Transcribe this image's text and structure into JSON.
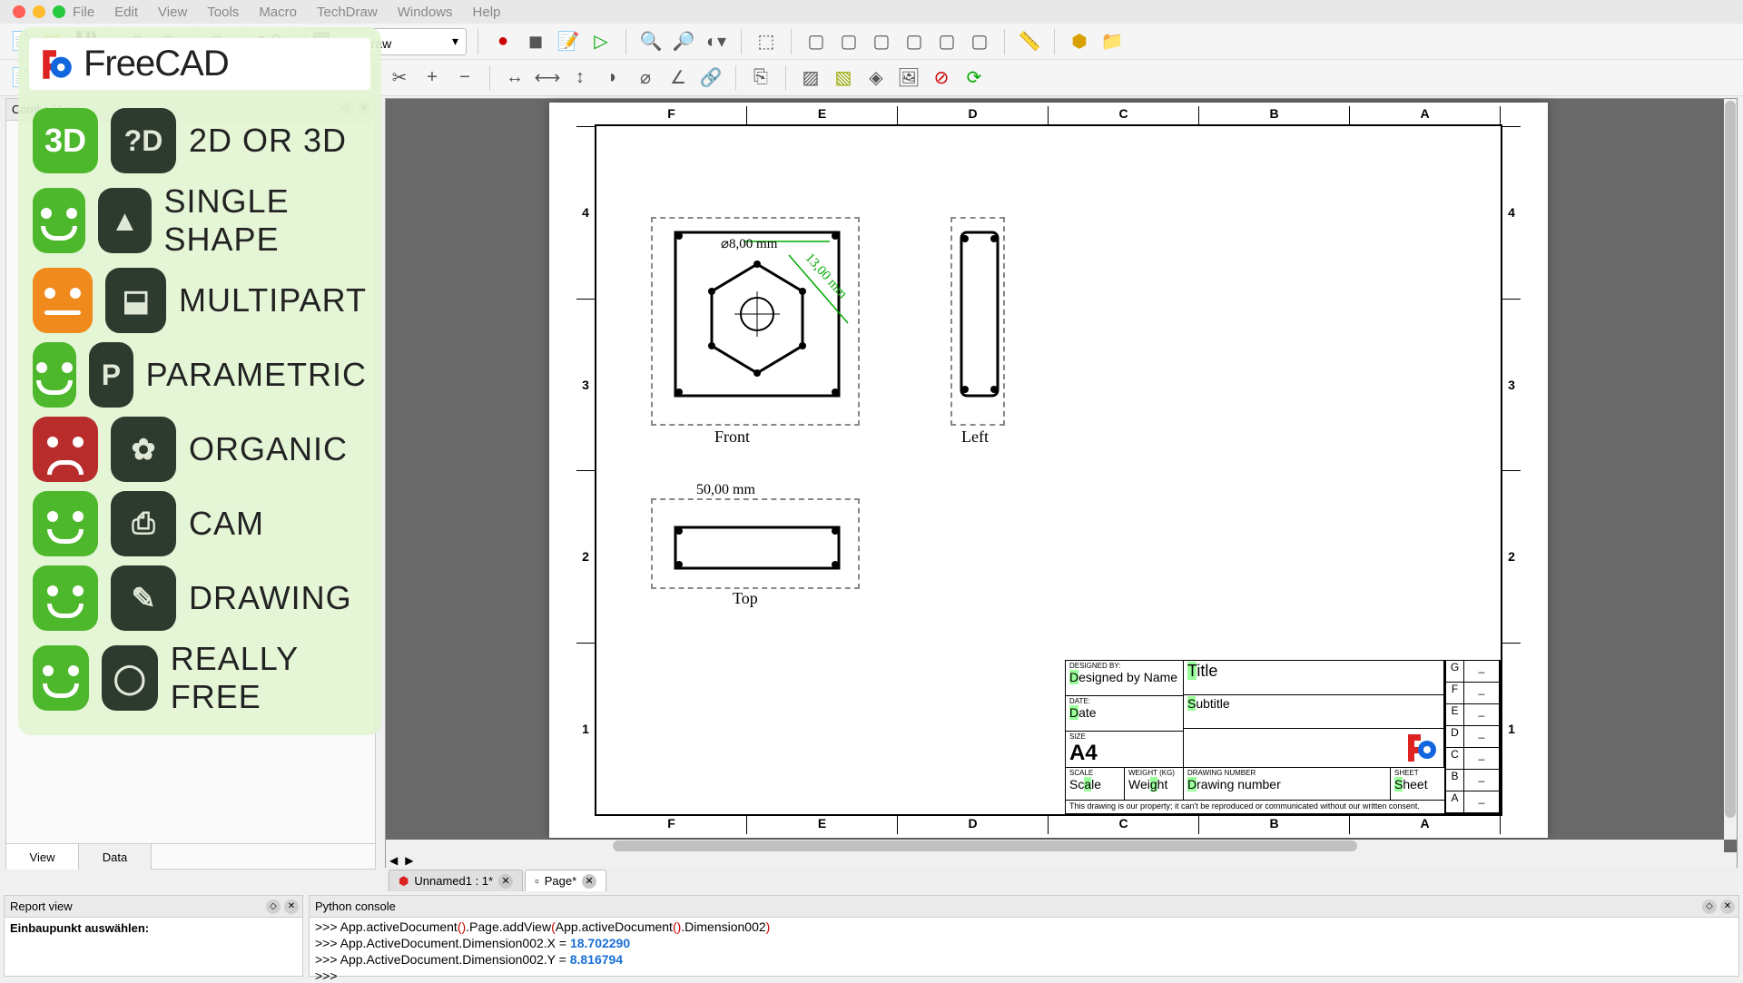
{
  "menu": {
    "items": [
      "File",
      "Edit",
      "View",
      "Tools",
      "Macro",
      "TechDraw",
      "Windows",
      "Help"
    ]
  },
  "workbench": {
    "selected": "TechDraw"
  },
  "combo": {
    "title": "Combo View",
    "tab_view": "View",
    "tab_data": "Data"
  },
  "overlay": {
    "brand": "FreeCAD",
    "features": [
      {
        "face": "3d",
        "icon": "?D",
        "label": "2D or 3D"
      },
      {
        "face": "green",
        "icon": "▲",
        "label": "Single Shape"
      },
      {
        "face": "orange",
        "icon": "⬓",
        "label": "Multipart"
      },
      {
        "face": "green",
        "icon": "P",
        "label": "Parametric"
      },
      {
        "face": "red",
        "icon": "✿",
        "label": "Organic"
      },
      {
        "face": "green",
        "icon": "⎙",
        "label": "CAM"
      },
      {
        "face": "green",
        "icon": "✎",
        "label": "Drawing"
      },
      {
        "face": "green",
        "icon": "◯",
        "label": "Really Free"
      }
    ]
  },
  "drawing": {
    "zones_h": [
      "F",
      "E",
      "D",
      "C",
      "B",
      "A"
    ],
    "zones_v": [
      "1",
      "2",
      "3",
      "4"
    ],
    "views": {
      "front": {
        "label": "Front",
        "dim_hole": "⌀8,00  mm",
        "dim_hex": "13,00 mm"
      },
      "left": {
        "label": "Left"
      },
      "top": {
        "label": "Top",
        "dim_w": "50,00  mm"
      }
    },
    "titleblock": {
      "designed_by_lbl": "DESIGNED BY:",
      "designed_by": "Designed by Name",
      "date_lbl": "DATE:",
      "date": "Date",
      "size_lbl": "SIZE",
      "size": "A4",
      "title": "Title",
      "subtitle": "Subtitle",
      "scale_lbl": "SCALE",
      "scale": "Scale",
      "weight_lbl": "WEIGHT (kg)",
      "weight": "Weight",
      "drawnum_lbl": "DRAWING NUMBER",
      "drawnum": "Drawing number",
      "sheet_lbl": "SHEET",
      "sheet": "Sheet",
      "revs": [
        "G",
        "F",
        "E",
        "D",
        "C",
        "B",
        "A"
      ],
      "legal": "This drawing is our property; it can't be reproduced or communicated without our written consent."
    }
  },
  "doctabs": {
    "one": "Unnamed1 : 1*",
    "two": "Page*"
  },
  "report": {
    "title": "Report view",
    "msg": "Einbaupunkt auswählen:"
  },
  "pycon": {
    "title": "Python console",
    "l1a": ">>> App.activeDocument",
    "l1b": ".Page.addView",
    "l1c": "App.activeDocument",
    "l1d": ".Dimension002",
    "l2a": ">>> App.ActiveDocument.Dimension002.X = ",
    "l2n": "18.702290",
    "l3a": ">>> App.ActiveDocument.Dimension002.Y = ",
    "l3n": "8.816794",
    "l4": ">>> "
  }
}
